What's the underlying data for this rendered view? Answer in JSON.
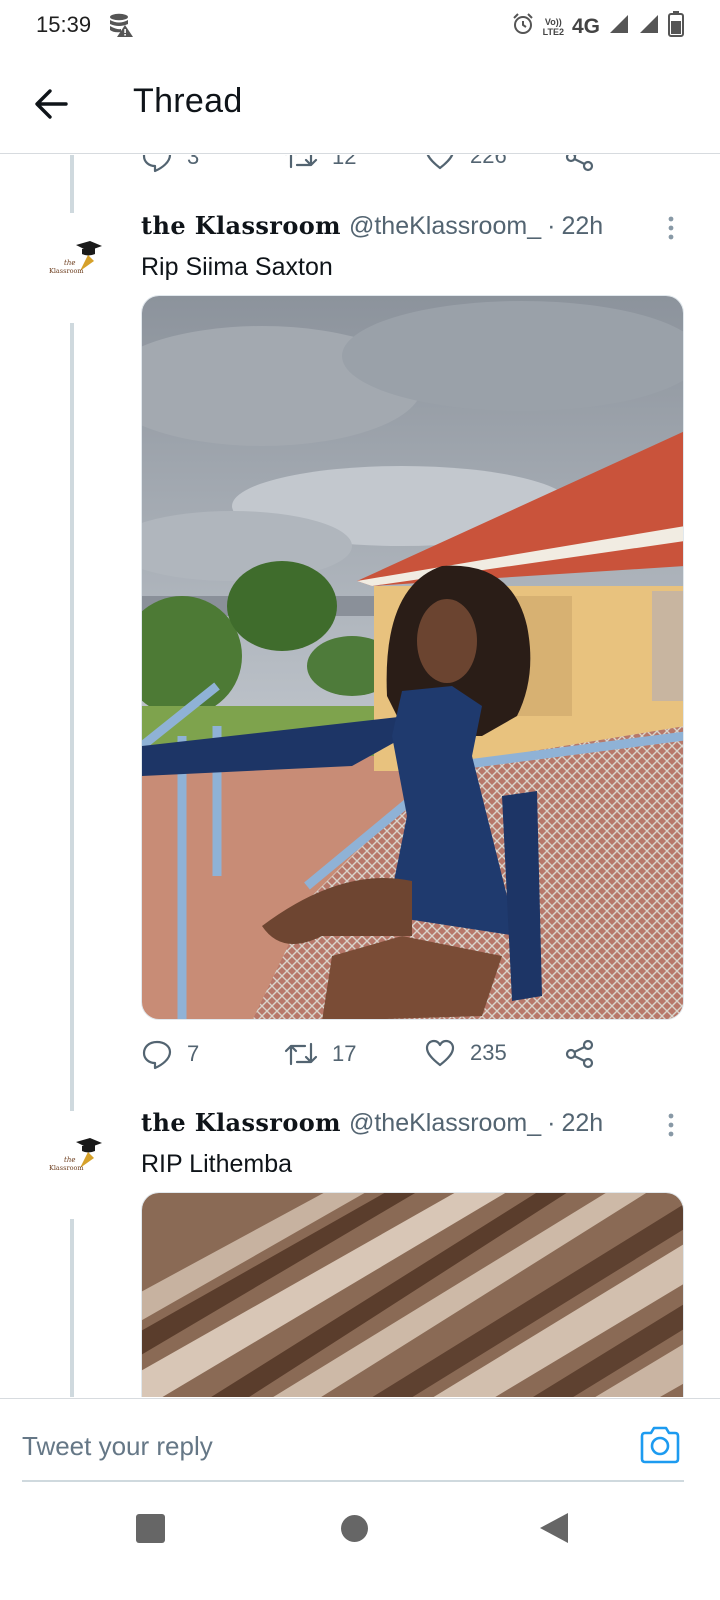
{
  "status_bar": {
    "time": "15:39",
    "volte_top": "Vo))",
    "volte_bottom": "LTE2",
    "network": "4G",
    "icons": [
      "data-saver-warning-icon",
      "alarm-icon",
      "signal-icon",
      "signal-icon",
      "battery-icon"
    ]
  },
  "header": {
    "title": "Thread",
    "back_icon": "arrow-left-icon"
  },
  "previous_tweet_actions": {
    "replies": "3",
    "retweets": "12",
    "likes": "226"
  },
  "tweets": [
    {
      "name": "the Klassroom",
      "handle": "@theKlassroom_",
      "separator": "·",
      "time": "22h",
      "text": "Rip Siima Saxton",
      "media": "photo",
      "replies": "7",
      "retweets": "17",
      "likes": "235"
    },
    {
      "name": "the Klassroom",
      "handle": "@theKlassroom_",
      "separator": "·",
      "time": "22h",
      "text": "RIP Lithemba",
      "media": "photo"
    }
  ],
  "reply_bar": {
    "placeholder": "Tweet your reply",
    "camera_icon": "camera-icon"
  },
  "colors": {
    "text_primary": "#0f1419",
    "text_secondary": "#536471",
    "accent": "#1d9bf0",
    "thread_line": "#cfd9de"
  }
}
